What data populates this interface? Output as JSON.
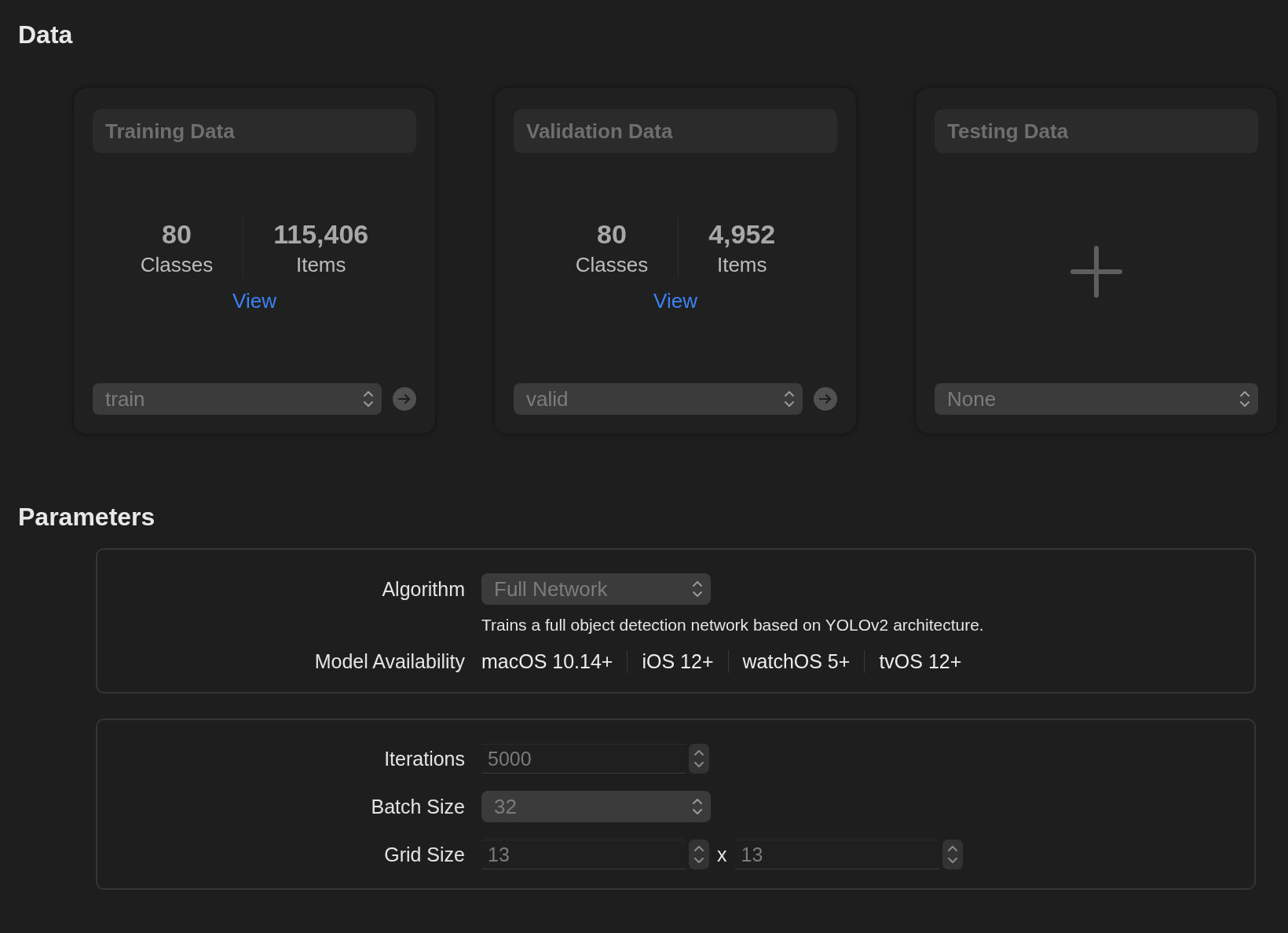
{
  "data": {
    "title": "Data",
    "cards": [
      {
        "kind": "stats",
        "title": "Training Data",
        "stats": [
          {
            "value": "80",
            "label": "Classes"
          },
          {
            "value": "115,406",
            "label": "Items"
          }
        ],
        "link": "View",
        "popup": "train"
      },
      {
        "kind": "stats",
        "title": "Validation Data",
        "stats": [
          {
            "value": "80",
            "label": "Classes"
          },
          {
            "value": "4,952",
            "label": "Items"
          }
        ],
        "link": "View",
        "popup": "valid"
      },
      {
        "kind": "empty",
        "title": "Testing Data",
        "popup": "None"
      }
    ]
  },
  "parameters": {
    "title": "Parameters",
    "panels": [
      {
        "rows": [
          {
            "kind": "popup",
            "label": "Algorithm",
            "value": "Full Network",
            "note": "Trains a full object detection network based on YOLOv2 architecture."
          },
          {
            "kind": "tags",
            "label": "Model Availability",
            "tags": [
              "macOS 10.14+",
              "iOS 12+",
              "watchOS 5+",
              "tvOS 12+"
            ]
          }
        ]
      },
      {
        "rows": [
          {
            "kind": "stepper",
            "label": "Iterations",
            "value": "5000"
          },
          {
            "kind": "popup",
            "label": "Batch Size",
            "value": "32"
          },
          {
            "kind": "pair",
            "label": "Grid Size",
            "values": [
              "13",
              "13"
            ],
            "separator": "x"
          }
        ]
      }
    ]
  }
}
